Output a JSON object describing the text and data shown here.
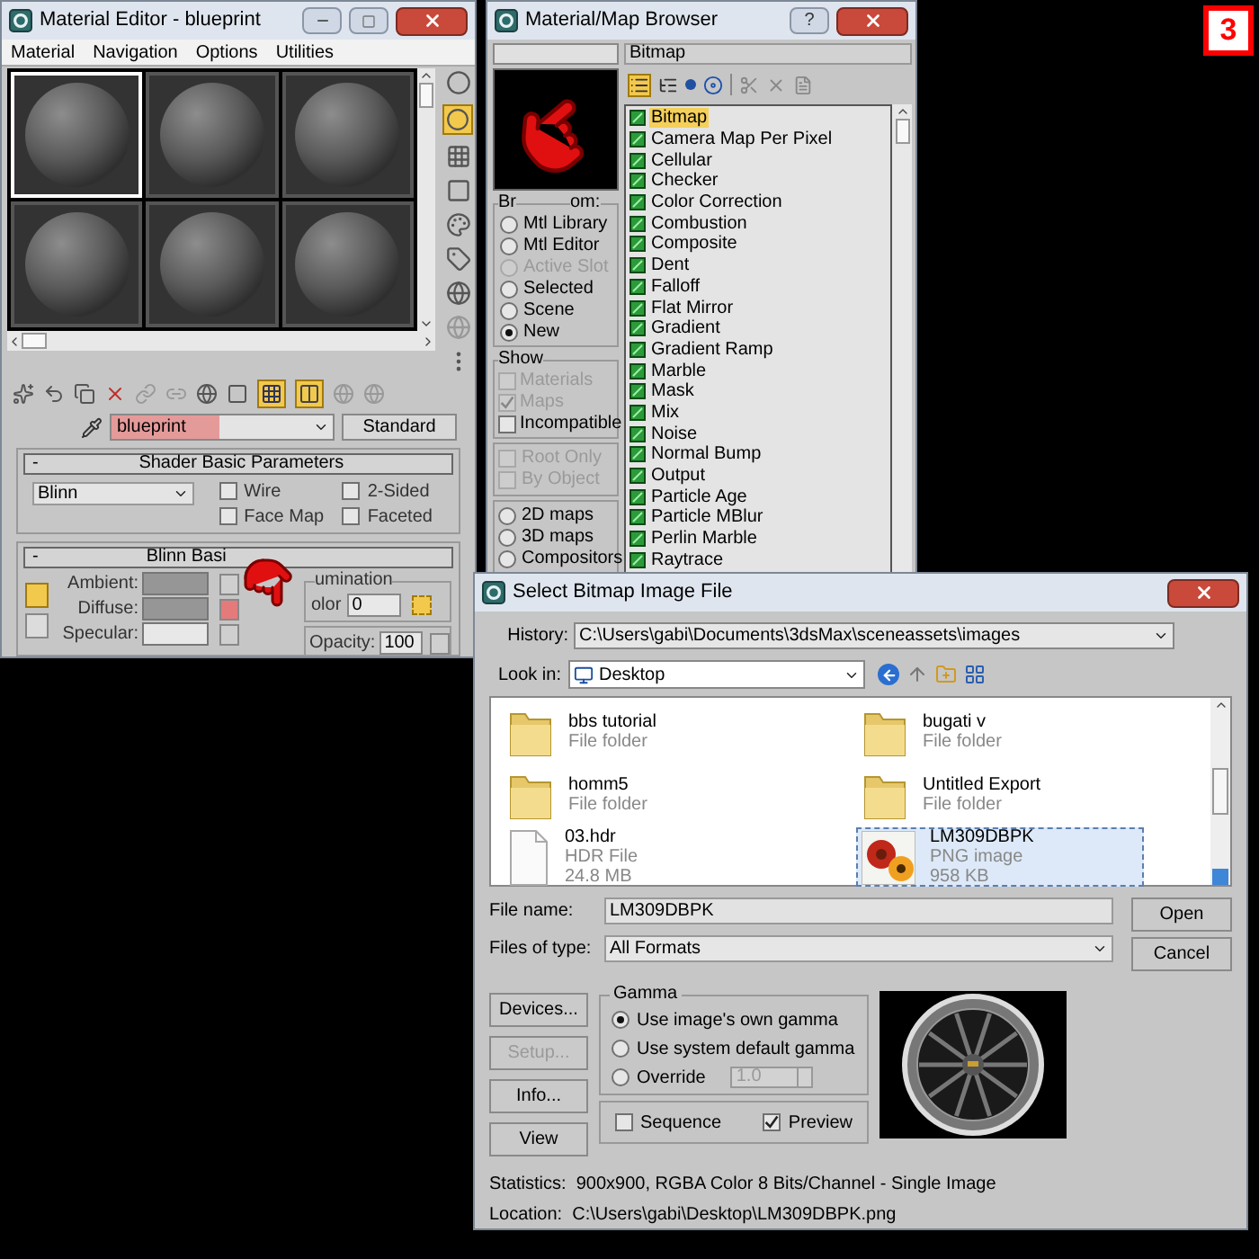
{
  "badge": "3",
  "material_editor": {
    "title": "Material Editor - blueprint",
    "menu": [
      "Material",
      "Navigation",
      "Options",
      "Utilities"
    ],
    "slots": [
      {
        "selected": true
      },
      {
        "selected": false
      },
      {
        "selected": false
      },
      {
        "selected": false
      },
      {
        "selected": false
      },
      {
        "selected": false
      }
    ],
    "material_name": "blueprint",
    "material_type": "Standard",
    "shader_params": {
      "sign": "-",
      "title": "Shader Basic Parameters",
      "shader": "Blinn",
      "options": [
        {
          "label": "Wire",
          "checked": false
        },
        {
          "label": "2-Sided",
          "checked": false
        },
        {
          "label": "Face Map",
          "checked": false
        },
        {
          "label": "Faceted",
          "checked": false
        }
      ]
    },
    "blinn_params": {
      "sign": "-",
      "title": "Blinn Basi",
      "self_illumination": "umination",
      "color_label": "olor",
      "color_value": "0",
      "swatches": [
        {
          "label": "Ambient:",
          "color": "#969696"
        },
        {
          "label": "Diffuse:",
          "color": "#969696"
        },
        {
          "label": "Specular:",
          "color": "#e8e8e8"
        }
      ],
      "opacity_label": "Opacity:",
      "opacity_value": "100"
    }
  },
  "map_browser": {
    "title": "Material/Map Browser",
    "help": "?",
    "category": "Bitmap",
    "browse_from": {
      "label_start": "Br",
      "label_end": "om:",
      "options": [
        {
          "label": "Mtl Library",
          "selected": false,
          "disabled": false
        },
        {
          "label": "Mtl Editor",
          "selected": false,
          "disabled": false
        },
        {
          "label": "Active Slot",
          "selected": false,
          "disabled": true
        },
        {
          "label": "Selected",
          "selected": false,
          "disabled": false
        },
        {
          "label": "Scene",
          "selected": false,
          "disabled": false
        },
        {
          "label": "New",
          "selected": true,
          "disabled": false
        }
      ]
    },
    "show": {
      "label": "Show",
      "options": [
        {
          "label": "Materials",
          "checked": false,
          "disabled": true
        },
        {
          "label": "Maps",
          "checked": true,
          "disabled": true
        },
        {
          "label": "Incompatible",
          "checked": false,
          "disabled": false
        }
      ]
    },
    "filters": [
      {
        "label": "Root Only",
        "checked": false,
        "disabled": true
      },
      {
        "label": "By Object",
        "checked": false,
        "disabled": true
      }
    ],
    "map_types": [
      {
        "label": "2D maps",
        "selected": false
      },
      {
        "label": "3D maps",
        "selected": false
      },
      {
        "label": "Compositors",
        "selected": false
      }
    ],
    "maps": [
      {
        "label": "Bitmap",
        "selected": true
      },
      {
        "label": "Camera Map Per Pixel",
        "selected": false
      },
      {
        "label": "Cellular",
        "selected": false
      },
      {
        "label": "Checker",
        "selected": false
      },
      {
        "label": "Color Correction",
        "selected": false
      },
      {
        "label": "Combustion",
        "selected": false
      },
      {
        "label": "Composite",
        "selected": false
      },
      {
        "label": "Dent",
        "selected": false
      },
      {
        "label": "Falloff",
        "selected": false
      },
      {
        "label": "Flat Mirror",
        "selected": false
      },
      {
        "label": "Gradient",
        "selected": false
      },
      {
        "label": "Gradient Ramp",
        "selected": false
      },
      {
        "label": "Marble",
        "selected": false
      },
      {
        "label": "Mask",
        "selected": false
      },
      {
        "label": "Mix",
        "selected": false
      },
      {
        "label": "Noise",
        "selected": false
      },
      {
        "label": "Normal Bump",
        "selected": false
      },
      {
        "label": "Output",
        "selected": false
      },
      {
        "label": "Particle Age",
        "selected": false
      },
      {
        "label": "Particle MBlur",
        "selected": false
      },
      {
        "label": "Perlin Marble",
        "selected": false
      },
      {
        "label": "Raytrace",
        "selected": false
      }
    ]
  },
  "file_dialog": {
    "title": "Select Bitmap Image File",
    "history_label": "History:",
    "history": "C:\\Users\\gabi\\Documents\\3dsMax\\sceneassets\\images",
    "look_in_label": "Look in:",
    "look_in": "Desktop",
    "files": [
      {
        "name": "bbs tutorial",
        "type": "File folder",
        "kind": "folder",
        "selected": false
      },
      {
        "name": "bugati v",
        "type": "File folder",
        "kind": "folder",
        "selected": false
      },
      {
        "name": "homm5",
        "type": "File folder",
        "kind": "folder",
        "selected": false
      },
      {
        "name": "Untitled Export",
        "type": "File folder",
        "kind": "folder",
        "selected": false
      },
      {
        "name": "03.hdr",
        "type": "HDR File",
        "size": "24.8 MB",
        "kind": "file",
        "selected": false
      },
      {
        "name": "LM309DBPK",
        "type": "PNG image",
        "size": "958 KB",
        "kind": "image",
        "selected": true
      }
    ],
    "file_name_label": "File name:",
    "file_name": "LM309DBPK",
    "file_type_label": "Files of type:",
    "file_type": "All Formats",
    "actions": [
      "Open",
      "Cancel"
    ],
    "side_buttons": [
      {
        "label": "Devices...",
        "disabled": false
      },
      {
        "label": "Setup...",
        "disabled": true
      },
      {
        "label": "Info...",
        "disabled": false
      },
      {
        "label": "View",
        "disabled": false
      }
    ],
    "gamma": {
      "title": "Gamma",
      "options": [
        {
          "label": "Use image's own gamma",
          "selected": true
        },
        {
          "label": "Use system default gamma",
          "selected": false
        },
        {
          "label": "Override",
          "selected": false
        }
      ],
      "override_value": "1.0"
    },
    "sequence": {
      "label": "Sequence",
      "checked": false
    },
    "preview": {
      "label": "Preview",
      "checked": true
    },
    "statistics": "Statistics:  900x900, RGBA Color 8 Bits/Channel - Single Image",
    "location": "Location:  C:\\Users\\gabi\\Desktop\\LM309DBPK.png"
  }
}
